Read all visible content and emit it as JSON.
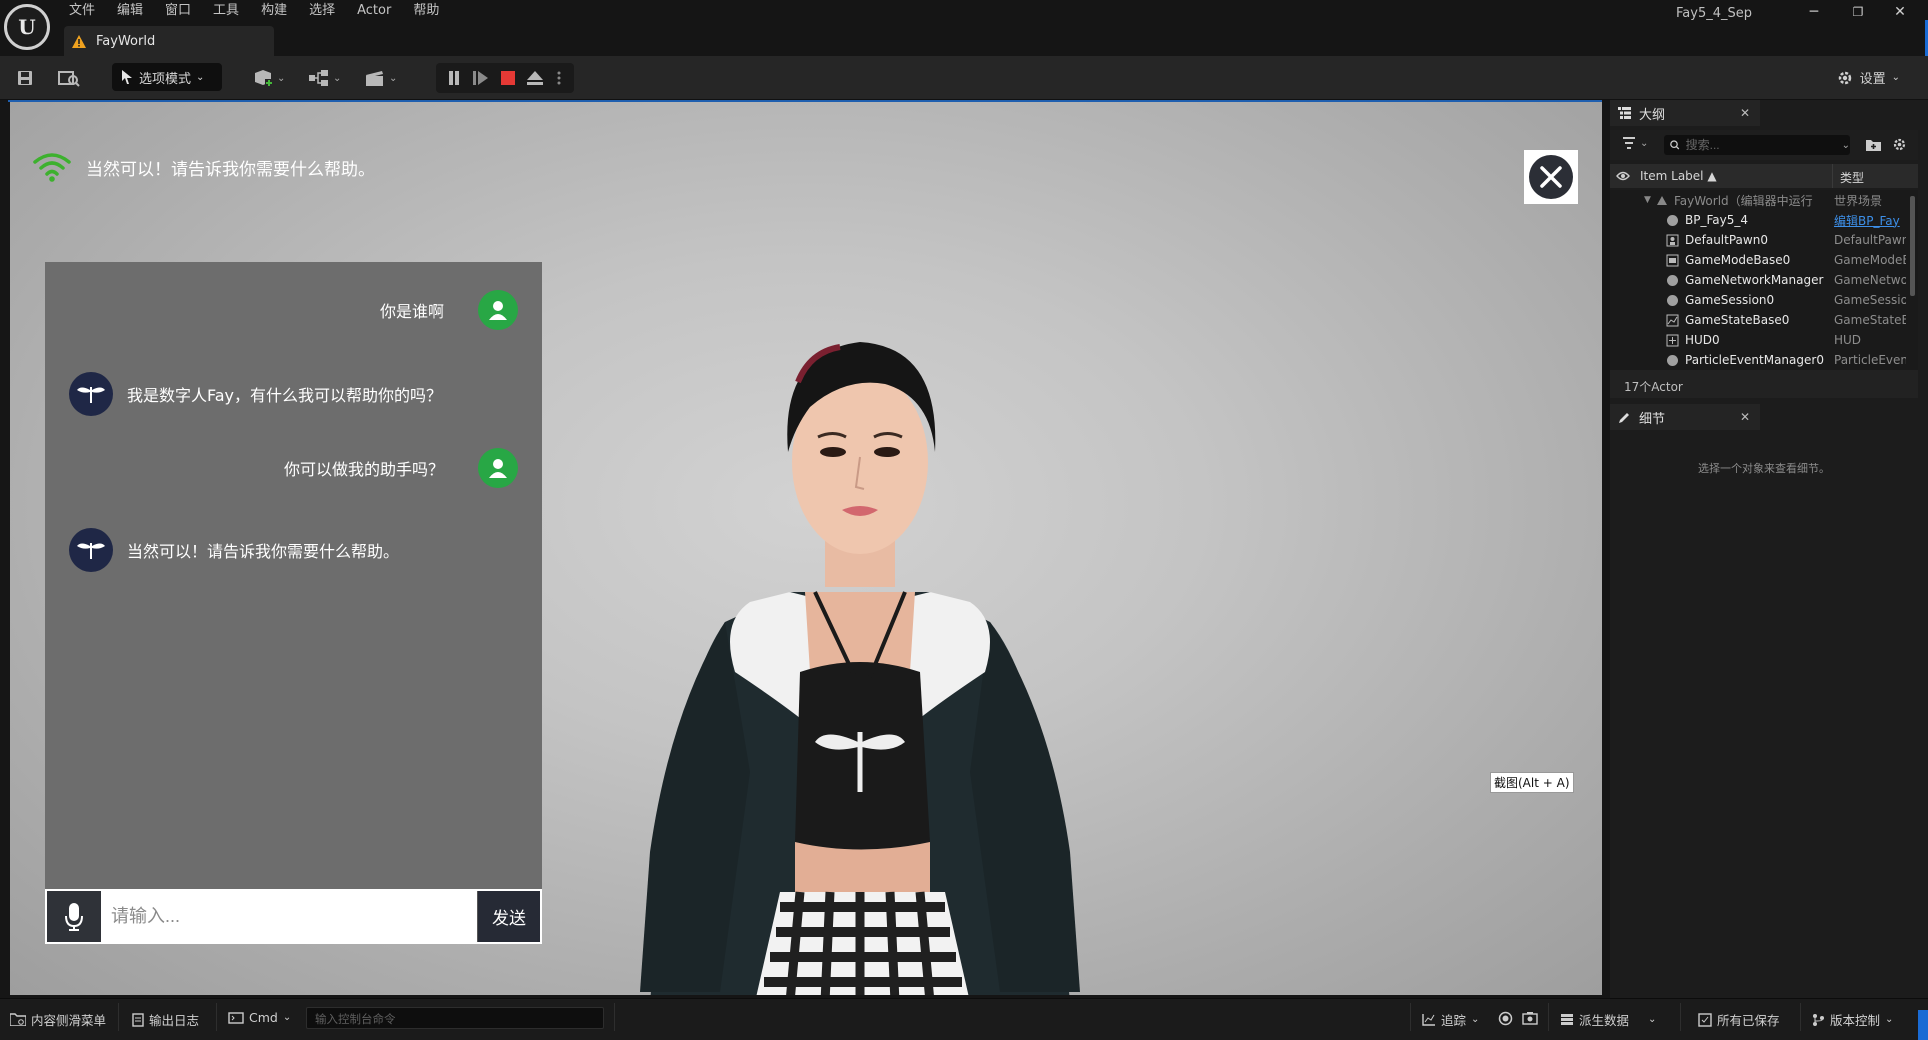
{
  "titlebar": {
    "menu": [
      "文件",
      "编辑",
      "窗口",
      "工具",
      "构建",
      "选择",
      "Actor",
      "帮助"
    ],
    "level_tab": "FayWorld",
    "project_name": "Fay5_4_Sep",
    "window_buttons": [
      "─",
      "❐",
      "✕"
    ]
  },
  "toolbar": {
    "mode_label": "选项模式",
    "settings_label": "设置"
  },
  "viewport": {
    "top_status_text": "当然可以！请告诉我你需要什么帮助。",
    "tooltip": "截图(Alt + A)",
    "chat": {
      "messages": [
        {
          "role": "user",
          "text": "你是谁啊"
        },
        {
          "role": "assistant",
          "text": "我是数字人Fay，有什么我可以帮助你的吗？"
        },
        {
          "role": "user",
          "text": "你可以做我的助手吗？"
        },
        {
          "role": "assistant",
          "text": "当然可以！请告诉我你需要什么帮助。"
        }
      ],
      "input_placeholder": "请输入...",
      "send_label": "发送"
    }
  },
  "outliner": {
    "tab_label": "大纲",
    "search_placeholder": "搜索...",
    "columns": {
      "label": "Item Label ▲",
      "type": "类型"
    },
    "root": {
      "name": "FayWorld（编辑器中运行",
      "type": "世界场景"
    },
    "rows": [
      {
        "name": "BP_Fay5_4",
        "type": "编辑BP_Fay",
        "icon": "blueprint-icon",
        "type_link": true
      },
      {
        "name": "DefaultPawn0",
        "type": "DefaultPawn",
        "icon": "pawn-icon"
      },
      {
        "name": "GameModeBase0",
        "type": "GameModeB",
        "icon": "game-mode-icon"
      },
      {
        "name": "GameNetworkManager",
        "type": "GameNetwo",
        "icon": "actor-icon"
      },
      {
        "name": "GameSession0",
        "type": "GameSessio",
        "icon": "actor-icon"
      },
      {
        "name": "GameStateBase0",
        "type": "GameStateB",
        "icon": "game-state-icon"
      },
      {
        "name": "HUD0",
        "type": "HUD",
        "icon": "hud-icon"
      },
      {
        "name": "ParticleEventManager0",
        "type": "ParticleEven",
        "icon": "actor-icon"
      }
    ],
    "actor_count": "17个Actor"
  },
  "details": {
    "tab_label": "细节",
    "hint": "选择一个对象来查看细节。"
  },
  "statusbar": {
    "content_drawer": "内容侧滑菜单",
    "output_log": "输出日志",
    "cmd_label": "Cmd",
    "cmd_placeholder": "输入控制台命令",
    "trace": "追踪",
    "derived_data": "派生数据",
    "all_saved": "所有已保存",
    "source_control": "版本控制"
  },
  "colors": {
    "accent": "#1a6bd4",
    "user_avatar": "#28a745",
    "assistant_avatar": "#1f2746",
    "wifi": "#3db12e",
    "record_stop": "#e53935"
  }
}
